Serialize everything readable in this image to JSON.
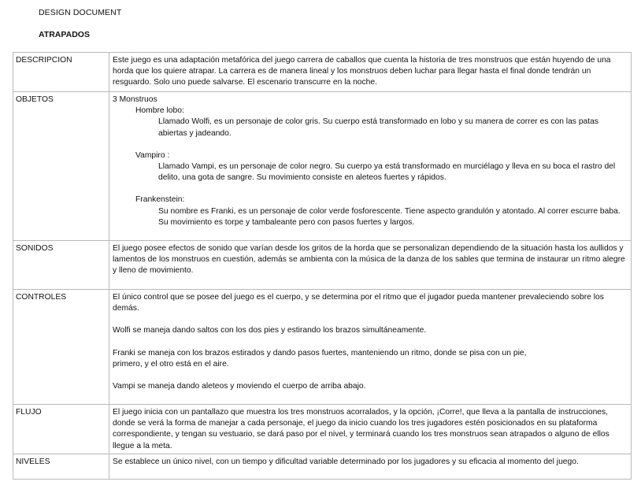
{
  "header": {
    "doc_label": "DESIGN DOCUMENT",
    "title": "ATRAPADOS"
  },
  "table": {
    "descripcion": {
      "label": "DESCRIPCION",
      "text": "Este juego es una adaptación metafórica del juego carrera de caballos que cuenta la historia de tres monstruos que están huyendo de una horda que los quiere atrapar. La carrera es de manera lineal y los monstruos deben luchar para llegar hasta el final donde tendrán un resguardo. Solo uno puede salvarse. El escenario transcurre en la noche."
    },
    "objetos": {
      "label": "OBJETOS",
      "intro": "3 Monstruos",
      "items": [
        {
          "name": "Hombre lobo:",
          "desc": "Llamado Wolfi, es un personaje de color gris. Su cuerpo está transformado en lobo y su manera de correr es con las patas abiertas y jadeando."
        },
        {
          "name": "Vampiro :",
          "desc": "Llamado Vampi, es un personaje de color negro. Su cuerpo ya está transformado en murciélago y lleva en su boca el rastro del delito, una gota de sangre. Su movimiento consiste en aleteos fuertes y rápidos."
        },
        {
          "name": "Frankenstein:",
          "desc": "Su nombre es Franki, es un personaje de color verde fosforescente. Tiene aspecto grandulón y atontado. Al correr escurre baba. Su movimiento es torpe y tambaleante pero con pasos fuertes y largos."
        }
      ]
    },
    "sonidos": {
      "label": "SONIDOS",
      "text": "El juego posee efectos de sonido que varían desde los gritos de la horda que se personalizan dependiendo de la situación hasta los aullidos y lamentos de los monstruos en cuestión, además se ambienta con la música de la danza de los sables que termina de instaurar un ritmo alegre y lleno de movimiento."
    },
    "controles": {
      "label": "CONTROLES",
      "p1": "El único control que se posee del juego es el cuerpo, y se determina por el ritmo que el jugador pueda mantener prevaleciendo sobre los demás.",
      "p2": "Wolfi se maneja dando saltos con los dos pies y estirando los brazos simultáneamente.",
      "p3a": "Franki se maneja con los brazos estirados y dando pasos fuertes, manteniendo un ritmo, donde se pisa con un pie,",
      "p3b": "primero, y el otro está en el aire.",
      "p4": "Vampi se maneja dando aleteos y moviendo el cuerpo de arriba abajo."
    },
    "flujo": {
      "label": "FLUJO",
      "text": "El juego inicia con un pantallazo que muestra los tres monstruos acorralados, y la opción, ¡Corre!, que lleva a la pantalla de instrucciones, donde se verá la forma de manejar a cada personaje, el juego da inicio cuando los tres jugadores estén posicionados en su plataforma correspondiente, y tengan su vestuario, se dará paso por el nivel, y terminará cuando los tres monstruos sean atrapados o alguno de ellos llegue a la meta."
    },
    "niveles": {
      "label": "NIVELES",
      "text": "Se establece un único nivel, con un tiempo y dificultad variable determinado por los jugadores y su eficacia al momento del juego."
    }
  }
}
